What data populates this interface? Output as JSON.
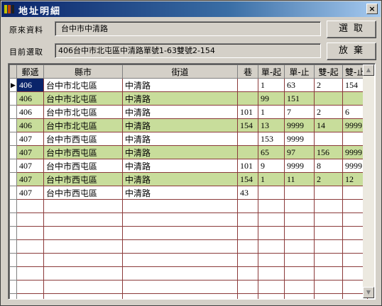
{
  "window": {
    "title": "地址明細",
    "close_label": "×"
  },
  "form": {
    "source_label": "原來資料",
    "source_value": "台中市中清路",
    "current_label": "目前選取",
    "current_value": "406台中市北屯區中清路單號1-63雙號2-154"
  },
  "buttons": {
    "select": "選取",
    "discard": "放棄"
  },
  "table": {
    "headers": [
      "郵遞",
      "縣市",
      "街道",
      "巷",
      "單-起",
      "單-止",
      "雙-起",
      "雙-止"
    ],
    "rows": [
      {
        "zip": "406",
        "city": "台中市北屯區",
        "street": "中清路",
        "lane": "",
        "s1": "1",
        "s2": "63",
        "d1": "2",
        "d2": "154",
        "green": false,
        "selected": true
      },
      {
        "zip": "406",
        "city": "台中市北屯區",
        "street": "中清路",
        "lane": "",
        "s1": "99",
        "s2": "151",
        "d1": "",
        "d2": "",
        "green": true,
        "selected": false
      },
      {
        "zip": "406",
        "city": "台中市北屯區",
        "street": "中清路",
        "lane": "101",
        "s1": "1",
        "s2": "7",
        "d1": "2",
        "d2": "6",
        "green": false,
        "selected": false
      },
      {
        "zip": "406",
        "city": "台中市北屯區",
        "street": "中清路",
        "lane": "154",
        "s1": "13",
        "s2": "9999",
        "d1": "14",
        "d2": "9999",
        "green": true,
        "selected": false
      },
      {
        "zip": "407",
        "city": "台中市西屯區",
        "street": "中清路",
        "lane": "",
        "s1": "153",
        "s2": "9999",
        "d1": "",
        "d2": "",
        "green": false,
        "selected": false
      },
      {
        "zip": "407",
        "city": "台中市西屯區",
        "street": "中清路",
        "lane": "",
        "s1": "65",
        "s2": "97",
        "d1": "156",
        "d2": "9999",
        "green": true,
        "selected": false
      },
      {
        "zip": "407",
        "city": "台中市西屯區",
        "street": "中清路",
        "lane": "101",
        "s1": "9",
        "s2": "9999",
        "d1": "8",
        "d2": "9999",
        "green": false,
        "selected": false
      },
      {
        "zip": "407",
        "city": "台中市西屯區",
        "street": "中清路",
        "lane": "154",
        "s1": "1",
        "s2": "11",
        "d1": "2",
        "d2": "12",
        "green": true,
        "selected": false
      },
      {
        "zip": "407",
        "city": "台中市西屯區",
        "street": "中清路",
        "lane": "43",
        "s1": "",
        "s2": "",
        "d1": "",
        "d2": "",
        "green": false,
        "selected": false
      }
    ],
    "empty_rows": 8,
    "row_marker": "▶"
  },
  "colors": {
    "row_green": "#c8dd9b",
    "selection": "#0a246a",
    "grid_line": "#8b3a3a"
  }
}
